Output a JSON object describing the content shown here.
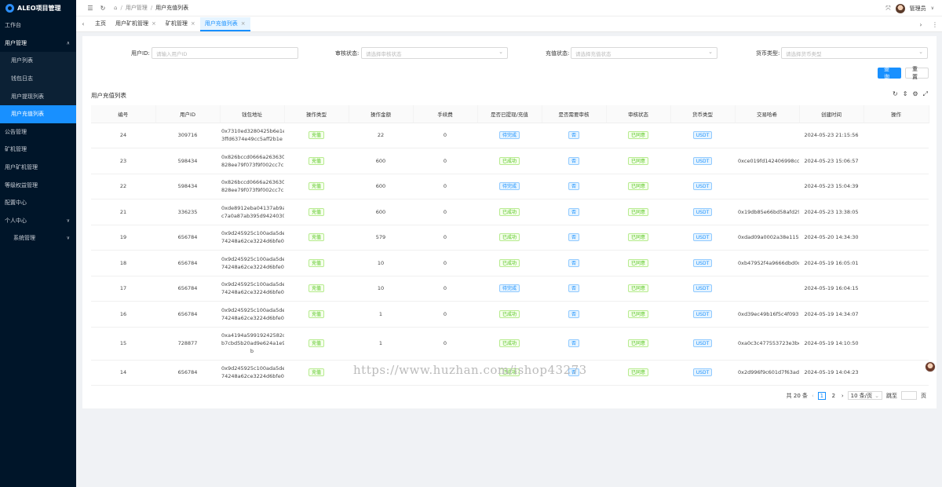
{
  "app": {
    "title": "ALEO项目管理"
  },
  "sidebar": {
    "items": [
      {
        "label": "工作台"
      },
      {
        "label": "用户管理",
        "arrow": "∧"
      },
      {
        "label": "用户列表"
      },
      {
        "label": "钱包日志"
      },
      {
        "label": "用户提现列表"
      },
      {
        "label": "用户充值列表"
      },
      {
        "label": "公告管理"
      },
      {
        "label": "矿机管理"
      },
      {
        "label": "用户矿机管理"
      },
      {
        "label": "等级权益管理"
      },
      {
        "label": "配置中心"
      },
      {
        "label": "个人中心",
        "arrow": "∨"
      },
      {
        "label": "系统管理",
        "arrow": "∨"
      }
    ]
  },
  "topbar": {
    "breadcrumb": [
      "用户管理",
      "用户充值列表"
    ],
    "user": "管理员"
  },
  "tabs": [
    {
      "label": "主页"
    },
    {
      "label": "用户矿机管理"
    },
    {
      "label": "矿机管理"
    },
    {
      "label": "用户充值列表"
    }
  ],
  "filters": {
    "user_id_label": "用户ID:",
    "user_id_placeholder": "请输入用户ID",
    "audit_label": "审核状态:",
    "audit_placeholder": "请选择审核状态",
    "recharge_label": "充值状态:",
    "recharge_placeholder": "请选择充值状态",
    "currency_label": "货币类型:",
    "currency_placeholder": "请选择货币类型",
    "search_btn": "查 询",
    "reset_btn": "重 置"
  },
  "section": {
    "title": "用户充值列表"
  },
  "table": {
    "headers": [
      "编号",
      "用户ID",
      "钱包地址",
      "操作类型",
      "操作金额",
      "手续费",
      "是否已提现/充值",
      "是否需要审核",
      "审核状态",
      "货币类型",
      "交易哈希",
      "创建时间",
      "操作"
    ],
    "rows": [
      {
        "id": "24",
        "uid": "309716",
        "addr1": "0x7310ed3280425b6e1e3",
        "addr2": "3ffd6374e49cc5aff2b1e",
        "addr3": "",
        "type": "充值",
        "amount": "22",
        "fee": "0",
        "done": "待完成",
        "need_audit": "否",
        "audit": "已同意",
        "currency": "USDT",
        "hash": "",
        "time": "2024-05-23 21:15:56"
      },
      {
        "id": "23",
        "uid": "598434",
        "addr1": "0x826bccd0666a2636307",
        "addr2": "828ee79f073f9f002cc7c",
        "addr3": "",
        "type": "充值",
        "amount": "600",
        "fee": "0",
        "done": "已成功",
        "need_audit": "否",
        "audit": "已同意",
        "currency": "USDT",
        "hash": "0xce019fd142406998cc750",
        "time": "2024-05-23 15:06:57"
      },
      {
        "id": "22",
        "uid": "598434",
        "addr1": "0x826bccd0666a2636307",
        "addr2": "828ee79f073f9f002cc7c",
        "addr3": "",
        "type": "充值",
        "amount": "600",
        "fee": "0",
        "done": "待完成",
        "need_audit": "否",
        "audit": "已同意",
        "currency": "USDT",
        "hash": "",
        "time": "2024-05-23 15:04:39"
      },
      {
        "id": "21",
        "uid": "336235",
        "addr1": "0xde8912eba04137ab9a6",
        "addr2": "c7a0a87ab395d94240305",
        "addr3": "",
        "type": "充值",
        "amount": "600",
        "fee": "0",
        "done": "已成功",
        "need_audit": "否",
        "audit": "已同意",
        "currency": "USDT",
        "hash": "0x19db85e66bd58afd29c1c",
        "time": "2024-05-23 13:38:05"
      },
      {
        "id": "19",
        "uid": "656784",
        "addr1": "0x9d245925c100ada5de9",
        "addr2": "74248a62ce3224d6bfe07",
        "addr3": "",
        "type": "充值",
        "amount": "579",
        "fee": "0",
        "done": "已成功",
        "need_audit": "否",
        "audit": "已同意",
        "currency": "USDT",
        "hash": "0xdad09a0002a38e115108",
        "time": "2024-05-20 14:34:30"
      },
      {
        "id": "18",
        "uid": "656784",
        "addr1": "0x9d245925c100ada5de9",
        "addr2": "74248a62ce3224d6bfe07",
        "addr3": "",
        "type": "充值",
        "amount": "10",
        "fee": "0",
        "done": "已成功",
        "need_audit": "否",
        "audit": "已同意",
        "currency": "USDT",
        "hash": "0xb47952f4a9666dbd0cc33",
        "time": "2024-05-19 16:05:01"
      },
      {
        "id": "17",
        "uid": "656784",
        "addr1": "0x9d245925c100ada5de9",
        "addr2": "74248a62ce3224d6bfe07",
        "addr3": "",
        "type": "充值",
        "amount": "10",
        "fee": "0",
        "done": "待完成",
        "need_audit": "否",
        "audit": "已同意",
        "currency": "USDT",
        "hash": "",
        "time": "2024-05-19 16:04:15"
      },
      {
        "id": "16",
        "uid": "656784",
        "addr1": "0x9d245925c100ada5de9",
        "addr2": "74248a62ce3224d6bfe07",
        "addr3": "",
        "type": "充值",
        "amount": "1",
        "fee": "0",
        "done": "已成功",
        "need_audit": "否",
        "audit": "已同意",
        "currency": "USDT",
        "hash": "0xd39ec49b16f5c4f093b71",
        "time": "2024-05-19 14:34:07"
      },
      {
        "id": "15",
        "uid": "728877",
        "addr1": "0xa4194a59919242582dc",
        "addr2": "b7cbd5b20ad9e624a1e9",
        "addr3": "b",
        "type": "充值",
        "amount": "1",
        "fee": "0",
        "done": "已成功",
        "need_audit": "否",
        "audit": "已同意",
        "currency": "USDT",
        "hash": "0xa0c3c477553723e3bee81",
        "time": "2024-05-19 14:10:50"
      },
      {
        "id": "14",
        "uid": "656784",
        "addr1": "0x9d245925c100ada5de9",
        "addr2": "74248a62ce3224d6bfe07",
        "addr3": "",
        "type": "充值",
        "amount": "",
        "fee": "",
        "done": "已成功",
        "need_audit": "否",
        "audit": "已同意",
        "currency": "USDT",
        "hash": "0x2d996f9c601d7f63ad3b4",
        "time": "2024-05-19 14:04:23"
      }
    ]
  },
  "pagination": {
    "total": "共 20 条",
    "pages": [
      "1",
      "2"
    ],
    "page_size": "10 条/页",
    "jump_label": "跳至",
    "jump_suffix": "页"
  },
  "watermark": "https://www.huzhan.com/ishop43273",
  "colors": {
    "primary": "#1890ff",
    "sidebar": "#001529",
    "success": "#52c41a"
  }
}
